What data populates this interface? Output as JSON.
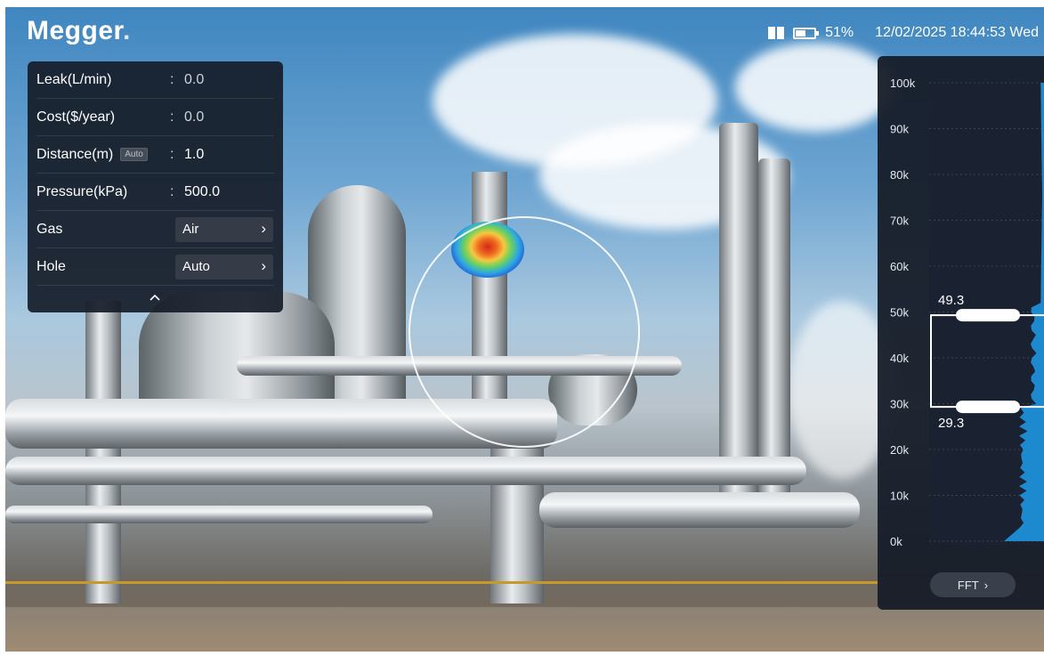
{
  "header": {
    "logo_text": "Megger",
    "logo_dot": ".",
    "battery_percent": "51%",
    "battery_level": 0.51,
    "datetime": "12/02/2025 18:44:53 Wed"
  },
  "params": {
    "leak": {
      "label": "Leak(L/min)",
      "colon": ":",
      "value": "0.0"
    },
    "cost": {
      "label": "Cost($/year)",
      "colon": ":",
      "value": "0.0"
    },
    "distance": {
      "label": "Distance(m)",
      "badge": "Auto",
      "colon": ":",
      "value": "1.0"
    },
    "pressure": {
      "label": "Pressure(kPa)",
      "colon": ":",
      "value": "500.0"
    },
    "gas": {
      "label": "Gas",
      "value": "Air",
      "chevron": "›"
    },
    "hole": {
      "label": "Hole",
      "value": "Auto",
      "chevron": "›"
    }
  },
  "spectrum": {
    "y_ticks": [
      "100k",
      "90k",
      "80k",
      "70k",
      "60k",
      "50k",
      "40k",
      "30k",
      "20k",
      "10k",
      "0k"
    ],
    "y_values": [
      100000,
      90000,
      80000,
      70000,
      60000,
      50000,
      40000,
      30000,
      20000,
      10000,
      0
    ],
    "upper_label": "49.3",
    "upper_value": 49.3,
    "lower_label": "29.3",
    "lower_value": 29.3,
    "fft_label": "FFT",
    "fft_chevron": "›"
  },
  "colors": {
    "accent_blue": "#1e8fd8",
    "panel_bg": "#161c28"
  },
  "icons": {
    "manual": "book-icon",
    "battery": "battery-icon",
    "collapse": "chevron-up-icon"
  }
}
